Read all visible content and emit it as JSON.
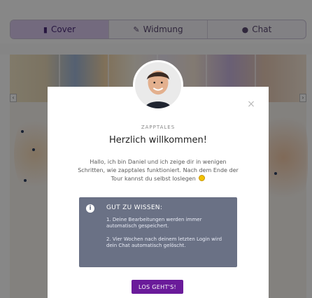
{
  "tabs": [
    {
      "label": "Cover",
      "icon": "book-icon"
    },
    {
      "label": "Widmung",
      "icon": "edit-icon"
    },
    {
      "label": "Chat",
      "icon": "comments-icon"
    }
  ],
  "modal": {
    "kicker": "ZAPPTALES",
    "title": "Herzlich willkommen!",
    "body": "Hallo, ich bin Daniel und ich zeige dir in wenigen Schritten, wie zapptales funktioniert. Nach dem Ende der Tour kannst du selbst loslegen",
    "close_icon": "×",
    "info": {
      "title": "GUT ZU WISSEN:",
      "items": [
        "1. Deine Bearbeitungen werden immer automatisch gespeichert.",
        "2. Vier Wochen nach deinem letzten Login wird dein Chat automatisch gelöscht."
      ]
    },
    "cta_label": "LOS GEHT'S!"
  },
  "colors": {
    "accent": "#6a1b9a",
    "info_box": "#6a7185",
    "active_tab": "#d9c9ef"
  }
}
